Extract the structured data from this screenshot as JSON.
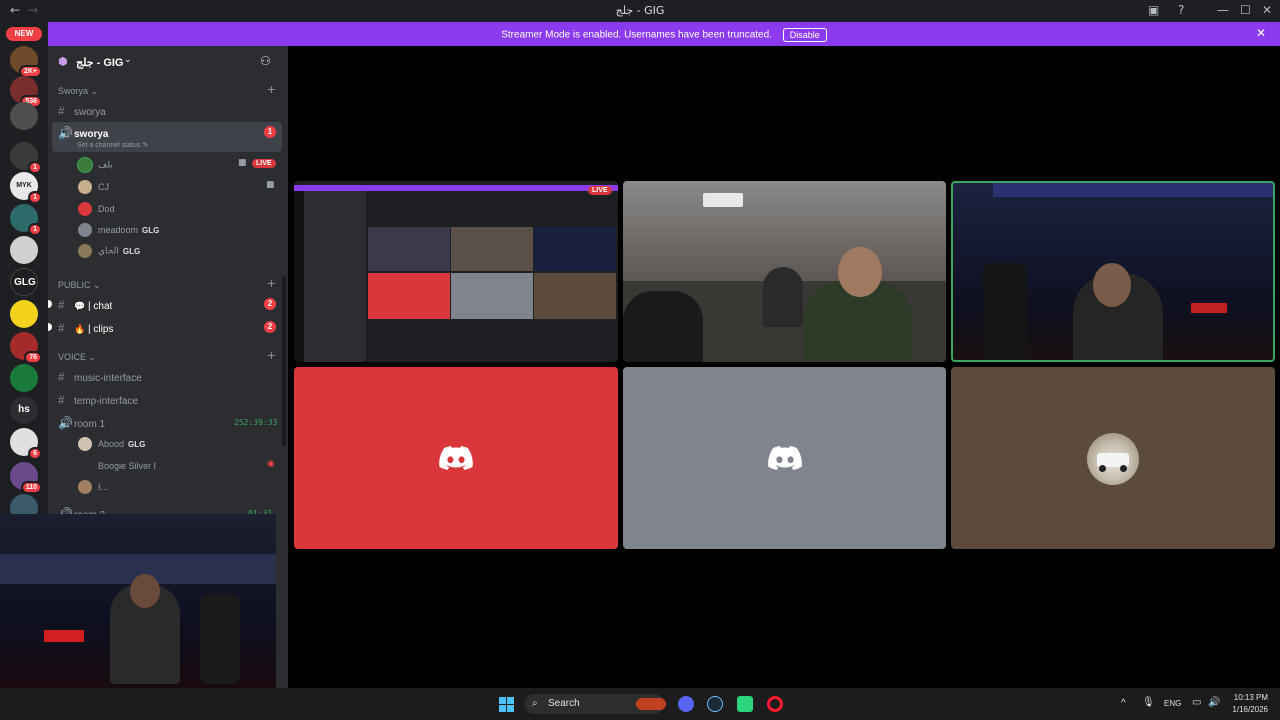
{
  "window": {
    "title": "جلج - GIG"
  },
  "banner": {
    "message": "Streamer Mode is enabled. Usernames have been truncated.",
    "disable_label": "Disable",
    "color": "#8c3aed"
  },
  "serverbar": {
    "new_label": "NEW",
    "servers": [
      {
        "badge": "2K+"
      },
      {
        "badge": "536"
      },
      {
        "badge": ""
      },
      {
        "badge": "1"
      },
      {
        "badge": "1",
        "text": "MYK"
      },
      {
        "badge": "1"
      },
      {
        "badge": ""
      },
      {
        "badge": "",
        "text": "GLG"
      },
      {
        "badge": ""
      },
      {
        "badge": "76"
      },
      {
        "badge": ""
      },
      {
        "badge": "",
        "text": "hs"
      },
      {
        "badge": "6"
      },
      {
        "badge": "110"
      },
      {
        "badge": ""
      }
    ]
  },
  "sidebar": {
    "guild_name": "جلج - GIG",
    "categories": {
      "sworya": "Sworya",
      "public": "PUBLIC",
      "voice": "VOICE"
    },
    "channels": {
      "sworya_text": "sworya",
      "sworya_voice": "sworya",
      "sworya_voice_status": "Set a channel status",
      "sworya_voice_mentions": "1",
      "chat": "| chat",
      "chat_mentions": "2",
      "clips": "| clips",
      "clips_mentions": "2",
      "music": "music-interface",
      "temp": "temp-interface",
      "room1": "room 1",
      "room1_timer": "252:39:33",
      "room2": "room 2",
      "room2_timer": "01:31"
    },
    "sworya_users": [
      {
        "name": "بلف",
        "live": "LIVE"
      },
      {
        "name": "CJ"
      },
      {
        "name": "Dod"
      },
      {
        "name": "meadoom",
        "tag": "GLG"
      },
      {
        "name": "الحاي",
        "tag": "GLG"
      }
    ],
    "room1_users": [
      {
        "name": "Abood",
        "tag": "GLG"
      },
      {
        "name": "Boogie Silver I"
      },
      {
        "name": "I..."
      }
    ]
  },
  "stage": {
    "screen_live_label": "LIVE",
    "tile_colors": {
      "red": "#da373c",
      "gray": "#80848e",
      "brown": "#5c4a3c",
      "speaking_border": "#3ba55d"
    }
  },
  "taskbar": {
    "search_label": "Search",
    "lang": "ENG",
    "time": "10:13 PM",
    "date": "1/16/2026"
  }
}
